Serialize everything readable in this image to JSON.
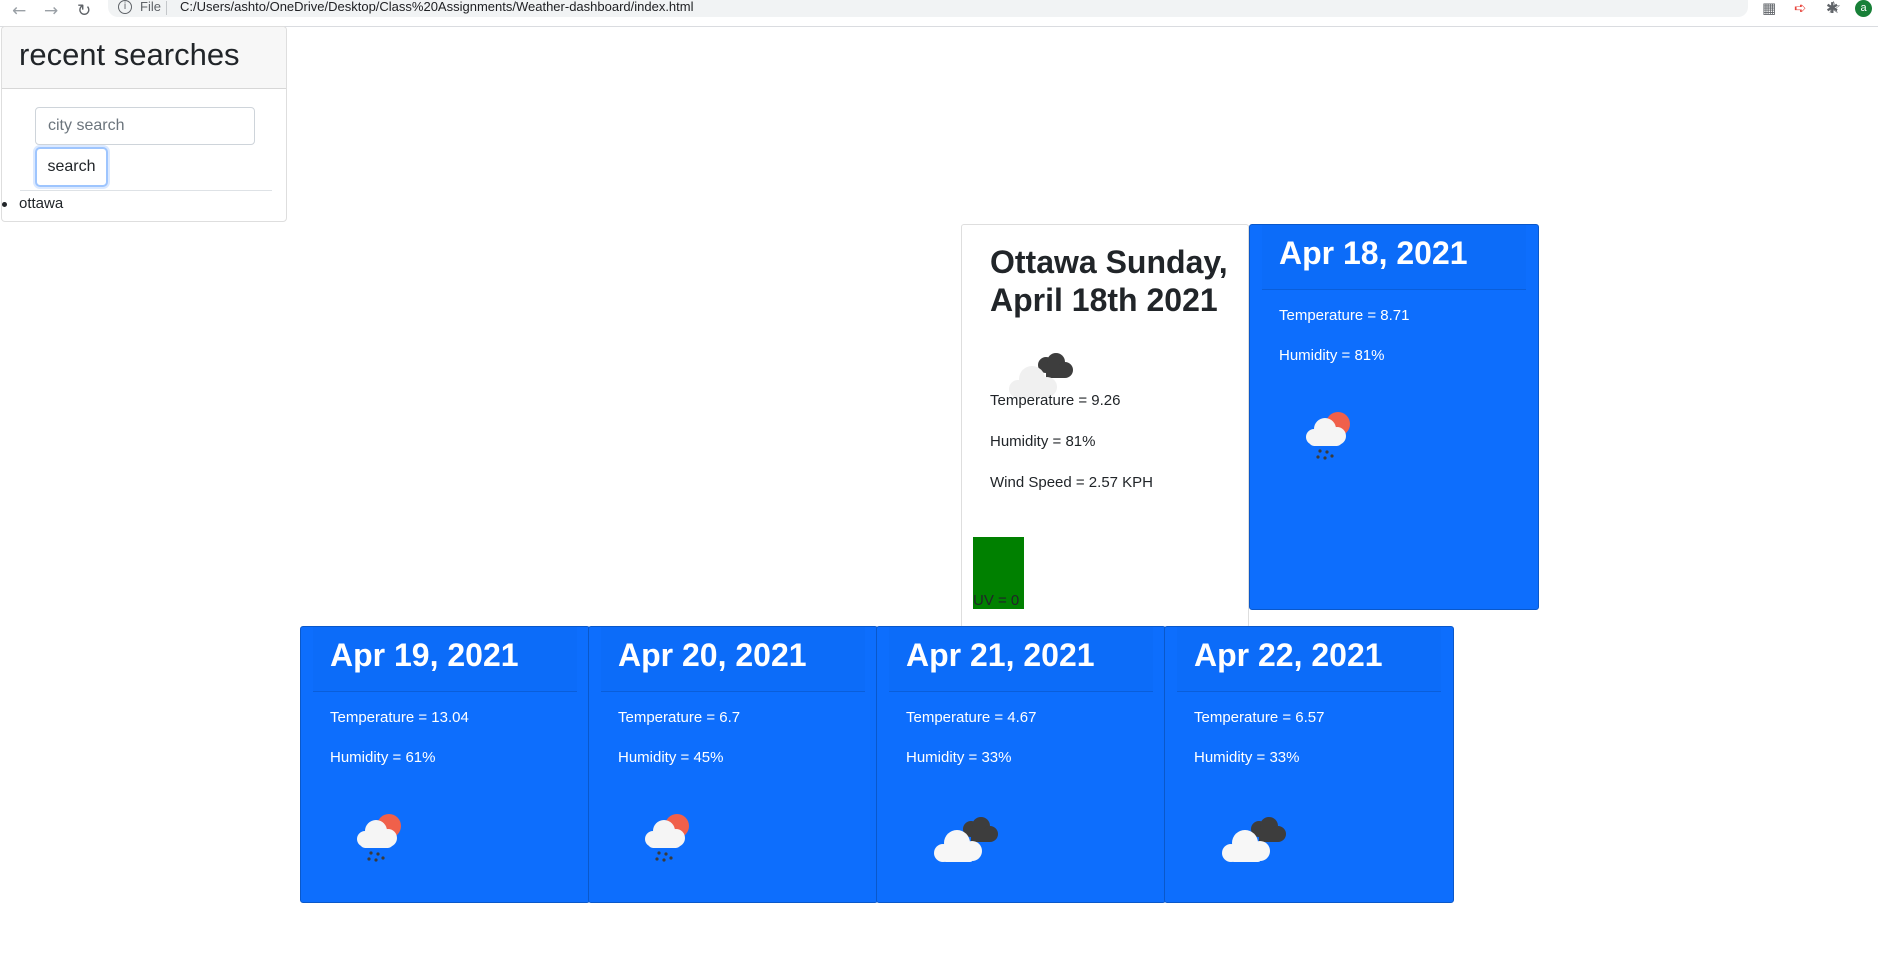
{
  "browser": {
    "scheme": "File",
    "url": "C:/Users/ashto/OneDrive/Desktop/Class%20Assignments/Weather-dashboard/index.html",
    "avatar_initial": "a"
  },
  "sidebar": {
    "title": "recent searches",
    "search_placeholder": "city search",
    "search_button": "search",
    "history": [
      "ottawa"
    ]
  },
  "current": {
    "title": "Ottawa Sunday, April 18th 2021",
    "icon": "dark-cloud-icon",
    "temperature": "Temperature = 9.26",
    "humidity": "Humidity = 81%",
    "wind": "Wind Speed = 2.57 KPH",
    "uv": "UV = 0",
    "uv_color": "#008000"
  },
  "forecast": [
    {
      "date": "Apr 18, 2021",
      "temperature": "Temperature = 8.71",
      "humidity": "Humidity = 81%",
      "icon": "sun-cloud-rain-icon"
    },
    {
      "date": "Apr 19, 2021",
      "temperature": "Temperature = 13.04",
      "humidity": "Humidity = 61%",
      "icon": "sun-cloud-rain-icon"
    },
    {
      "date": "Apr 20, 2021",
      "temperature": "Temperature = 6.7",
      "humidity": "Humidity = 45%",
      "icon": "sun-cloud-rain-icon"
    },
    {
      "date": "Apr 21, 2021",
      "temperature": "Temperature = 4.67",
      "humidity": "Humidity = 33%",
      "icon": "dark-cloud-icon"
    },
    {
      "date": "Apr 22, 2021",
      "temperature": "Temperature = 6.57",
      "humidity": "Humidity = 33%",
      "icon": "dark-cloud-icon"
    }
  ],
  "colors": {
    "card_blue": "#0d6efd",
    "uv_green": "#008000"
  }
}
